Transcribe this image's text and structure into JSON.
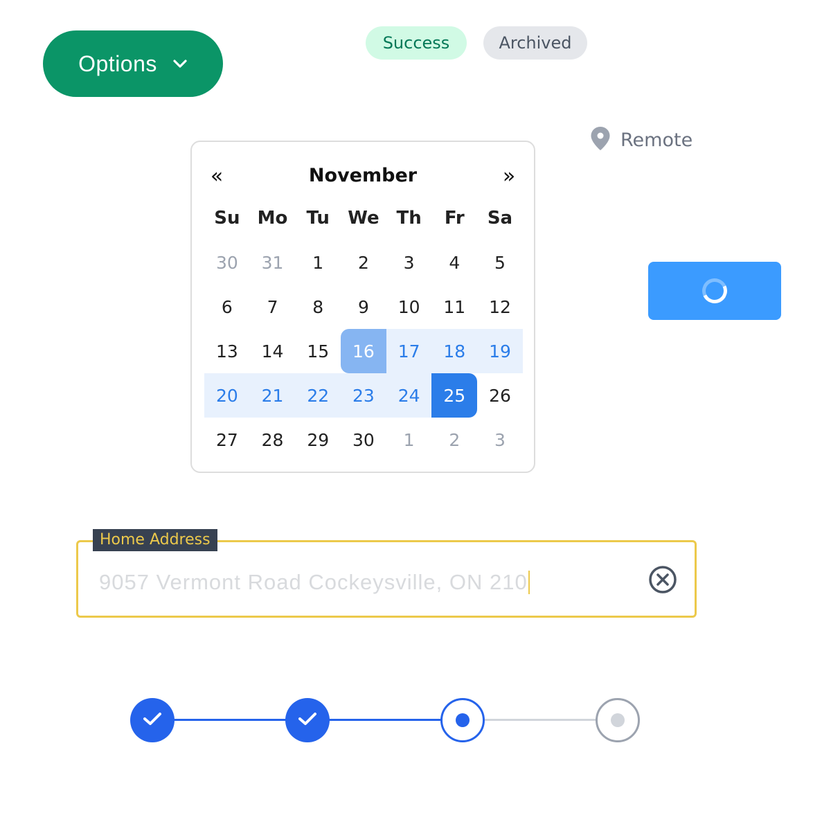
{
  "colors": {
    "options_bg": "#0b9567",
    "success_bg": "#d1fae5",
    "success_text": "#047857",
    "archived_bg": "#e5e7eb",
    "archived_text": "#4b5563",
    "loading_bg": "#3b9bff",
    "step_active": "#2563eb",
    "step_inactive": "#d1d5db"
  },
  "options_button": {
    "label": "Options",
    "icon": "chevron-down-icon"
  },
  "badges": {
    "success": "Success",
    "archived": "Archived"
  },
  "location": {
    "icon": "map-pin-icon",
    "text": "Remote"
  },
  "calendar": {
    "month": "November",
    "prev_icon": "«",
    "next_icon": "»",
    "weekdays": [
      "Su",
      "Mo",
      "Tu",
      "We",
      "Th",
      "Fr",
      "Sa"
    ],
    "weeks": [
      [
        {
          "d": "30",
          "s": "muted"
        },
        {
          "d": "31",
          "s": "muted"
        },
        {
          "d": "1"
        },
        {
          "d": "2"
        },
        {
          "d": "3"
        },
        {
          "d": "4"
        },
        {
          "d": "5"
        }
      ],
      [
        {
          "d": "6"
        },
        {
          "d": "7"
        },
        {
          "d": "8"
        },
        {
          "d": "9"
        },
        {
          "d": "10"
        },
        {
          "d": "11"
        },
        {
          "d": "12"
        }
      ],
      [
        {
          "d": "13"
        },
        {
          "d": "14"
        },
        {
          "d": "15"
        },
        {
          "d": "16",
          "s": "range-start"
        },
        {
          "d": "17",
          "s": "in-range"
        },
        {
          "d": "18",
          "s": "in-range"
        },
        {
          "d": "19",
          "s": "in-range"
        }
      ],
      [
        {
          "d": "20",
          "s": "in-range"
        },
        {
          "d": "21",
          "s": "in-range"
        },
        {
          "d": "22",
          "s": "in-range"
        },
        {
          "d": "23",
          "s": "in-range"
        },
        {
          "d": "24",
          "s": "in-range"
        },
        {
          "d": "25",
          "s": "range-end"
        },
        {
          "d": "26"
        }
      ],
      [
        {
          "d": "27"
        },
        {
          "d": "28"
        },
        {
          "d": "29"
        },
        {
          "d": "30"
        },
        {
          "d": "1",
          "s": "muted"
        },
        {
          "d": "2",
          "s": "muted"
        },
        {
          "d": "3",
          "s": "muted"
        }
      ]
    ]
  },
  "loading_button": {
    "state": "loading"
  },
  "address_field": {
    "label": "Home Address",
    "value": "9057 Vermont Road Cockeysville, ON 210",
    "clear_icon": "clear-circle-icon"
  },
  "stepper": {
    "steps": [
      {
        "state": "done"
      },
      {
        "state": "done"
      },
      {
        "state": "current"
      },
      {
        "state": "pending"
      }
    ]
  }
}
